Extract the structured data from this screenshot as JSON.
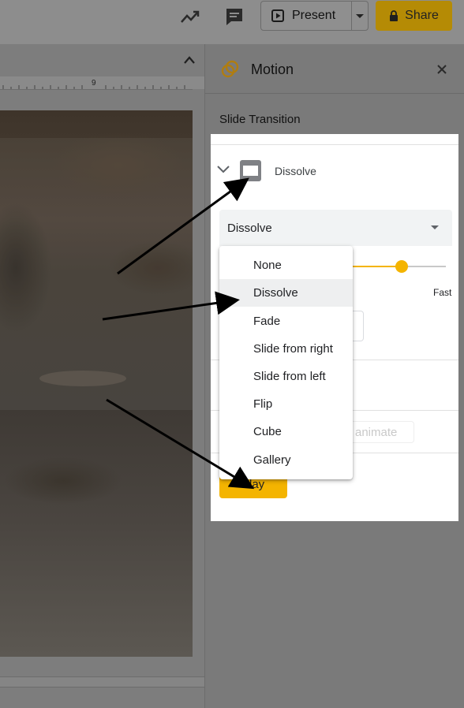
{
  "toolbar": {
    "present_label": "Present",
    "share_label": "Share",
    "icons": [
      "trending-up-icon",
      "comment-icon",
      "present-play-icon",
      "lock-icon",
      "caret-down-icon"
    ]
  },
  "editor": {
    "ruler_number": "9"
  },
  "motion_panel": {
    "title": "Motion",
    "section_label": "Slide Transition",
    "transition_name": "Dissolve",
    "selected_type": "Dissolve",
    "speed_fast_label": "Fast",
    "speed_level_fraction": 0.53,
    "animate_label": "animate",
    "play_label": "Play"
  },
  "dropdown": {
    "options": [
      "None",
      "Dissolve",
      "Fade",
      "Slide from right",
      "Slide from left",
      "Flip",
      "Cube",
      "Gallery"
    ],
    "selected": "Dissolve"
  },
  "colors": {
    "accent": "#f4b400",
    "overlay_dim": "#7a7a7a",
    "share_dimmed": "#b58b05"
  }
}
